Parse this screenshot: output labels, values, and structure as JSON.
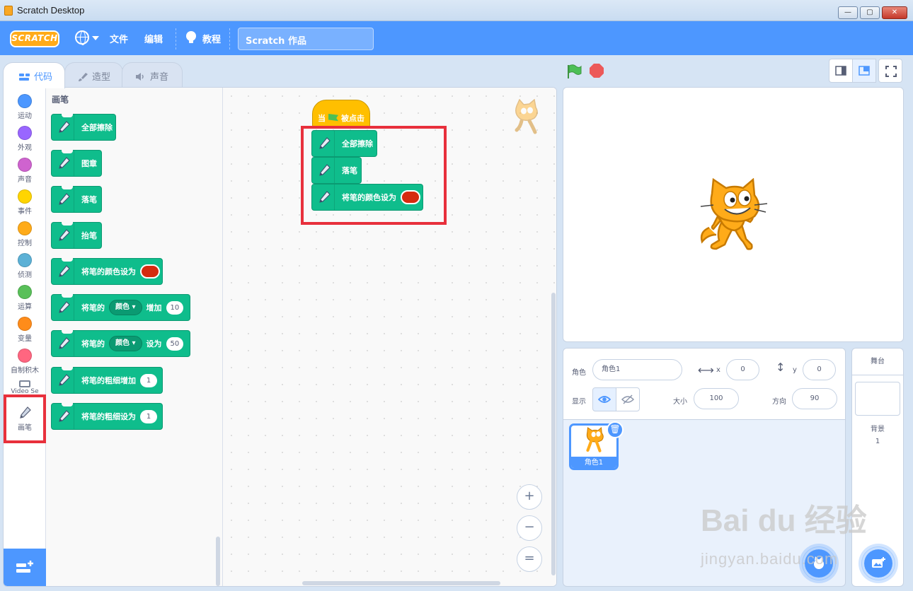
{
  "window": {
    "title": "Scratch Desktop",
    "min": "—",
    "max": "▢",
    "close": "✕"
  },
  "menubar": {
    "logo": "SCRATCH",
    "file": "文件",
    "edit": "编辑",
    "tutorials": "教程",
    "project_title": "Scratch 作品"
  },
  "tabs": [
    {
      "label": "代码",
      "active": true
    },
    {
      "label": "造型",
      "active": false
    },
    {
      "label": "声音",
      "active": false
    }
  ],
  "categories": [
    {
      "label": "运动",
      "color": "#4c97ff"
    },
    {
      "label": "外观",
      "color": "#9966ff"
    },
    {
      "label": "声音",
      "color": "#cf63cf"
    },
    {
      "label": "事件",
      "color": "#ffd500"
    },
    {
      "label": "控制",
      "color": "#ffab19"
    },
    {
      "label": "侦测",
      "color": "#5cb1d6"
    },
    {
      "label": "运算",
      "color": "#59c059"
    },
    {
      "label": "变量",
      "color": "#ff8c1a"
    },
    {
      "label": "自制积木",
      "color": "#ff6680"
    },
    {
      "label": "Video Se",
      "color": "#0fbd8c"
    },
    {
      "label": "画笔",
      "color": "#0fbd8c"
    }
  ],
  "palette": {
    "title": "画笔",
    "blocks": [
      {
        "text": "全部擦除"
      },
      {
        "text": "图章"
      },
      {
        "text": "落笔"
      },
      {
        "text": "抬笔"
      },
      {
        "text": "将笔的颜色设为"
      },
      {
        "pre": "将笔的",
        "dropdown": "颜色",
        "post": "增加",
        "value": "10"
      },
      {
        "pre": "将笔的",
        "dropdown": "颜色",
        "post": "设为",
        "value": "50"
      },
      {
        "text": "将笔的粗细增加",
        "value": "1"
      },
      {
        "text": "将笔的粗细设为",
        "value": "1"
      }
    ]
  },
  "workspace": {
    "hat": {
      "pre": "当",
      "post": "被点击"
    },
    "script": [
      "全部擦除",
      "落笔",
      "将笔的颜色设为"
    ],
    "zoom_in": "+",
    "zoom_out": "−",
    "zoom_reset": "="
  },
  "sprite_info": {
    "sprite_label": "角色",
    "sprite_name": "角色1",
    "x_label": "x",
    "x_value": "0",
    "y_label": "y",
    "y_value": "0",
    "show_label": "显示",
    "size_label": "大小",
    "size_value": "100",
    "direction_label": "方向",
    "direction_value": "90"
  },
  "sprites": [
    {
      "name": "角色1"
    }
  ],
  "stage_pane": {
    "title": "舞台",
    "backdrops_label": "背景",
    "backdrops_count": "1"
  },
  "watermark": {
    "main": "Bai du 经验",
    "sub": "jingyan.baidu.com"
  },
  "colors": {
    "accent": "#4d97ff",
    "pen": "#0fbd8c",
    "pen_color_value": "#d52b0f",
    "event": "#ffbf00",
    "highlight": "#e8303c"
  }
}
